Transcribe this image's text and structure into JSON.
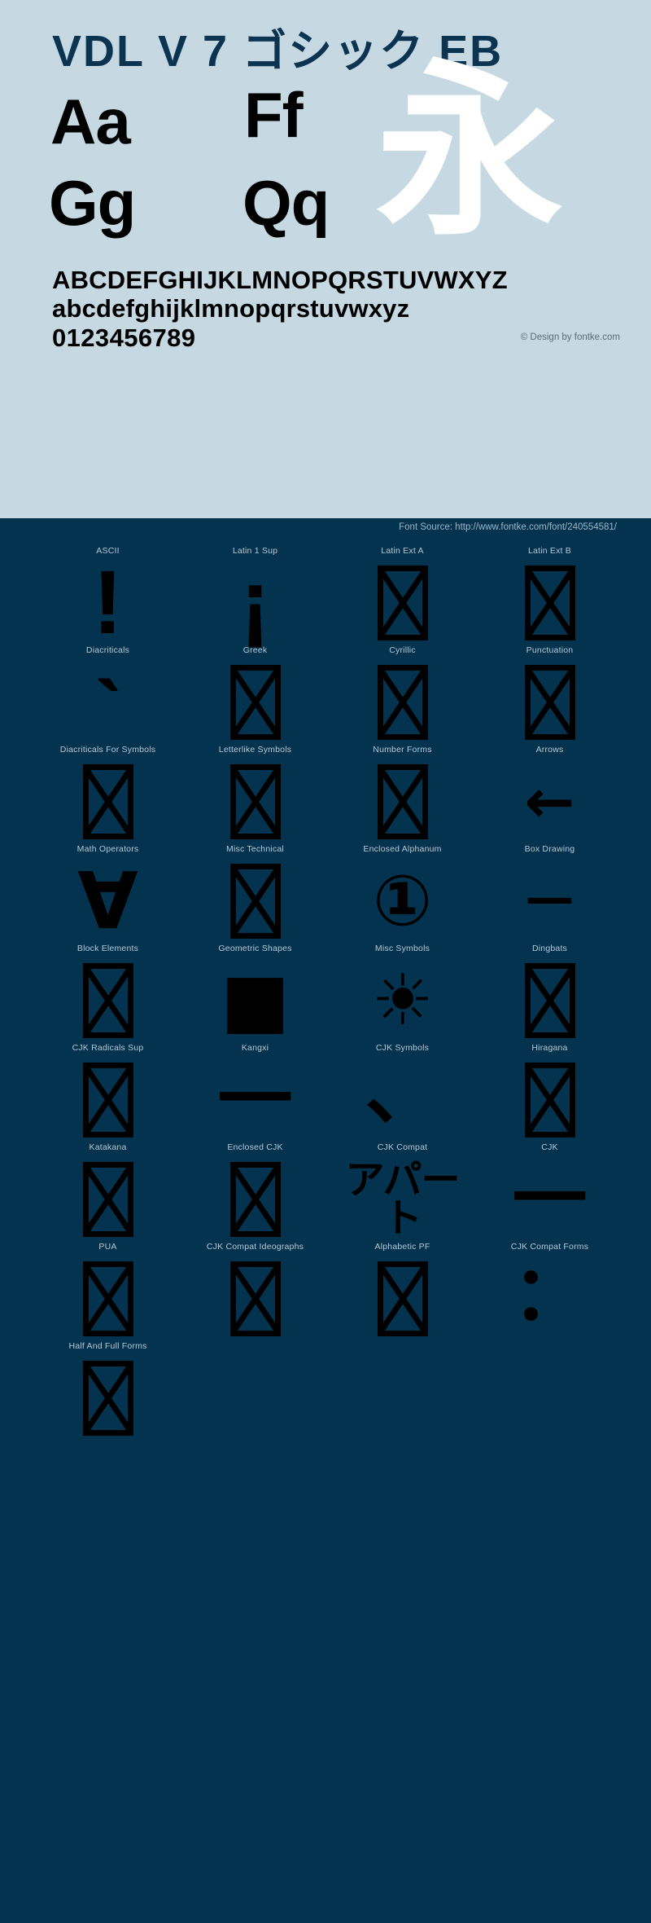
{
  "specimen": {
    "title": "VDL V 7 ゴシック EB",
    "samples": {
      "aa": "Aa",
      "ff": "Ff",
      "gg": "Gg",
      "qq": "Qq",
      "cjk": "永"
    },
    "alphabet": {
      "uppercase": "ABCDEFGHIJKLMNOPQRSTUVWXYZ",
      "lowercase": "abcdefghijklmnopqrstuvwxyz",
      "digits": "0123456789"
    },
    "credit": "© Design by fontke.com",
    "colors": {
      "specimen_background": "#c6d9e2",
      "title": "#0c3450",
      "glyph_black": "#000000",
      "cjk_white": "#ffffff",
      "panel_background": "#043350",
      "label": "#b6c8d4"
    }
  },
  "source_bar": {
    "text": "Font Source: http://www.fontke.com/font/240554581/"
  },
  "glyph_grid": {
    "cells": [
      {
        "label": "ASCII",
        "glyph": "!",
        "kind": "real",
        "style": "g-exclam"
      },
      {
        "label": "Latin 1 Sup",
        "glyph": "¡",
        "kind": "real",
        "style": "g-invexcl"
      },
      {
        "label": "Latin Ext A",
        "glyph": "",
        "kind": "tofu",
        "style": ""
      },
      {
        "label": "Latin Ext B",
        "glyph": "",
        "kind": "tofu",
        "style": ""
      },
      {
        "label": "Diacriticals",
        "glyph": "ˋ",
        "kind": "real",
        "style": "g-grave"
      },
      {
        "label": "Greek",
        "glyph": "",
        "kind": "tofu",
        "style": ""
      },
      {
        "label": "Cyrillic",
        "glyph": "",
        "kind": "tofu",
        "style": ""
      },
      {
        "label": "Punctuation",
        "glyph": "",
        "kind": "tofu",
        "style": ""
      },
      {
        "label": "Diacriticals For Symbols",
        "glyph": "",
        "kind": "tofu",
        "style": ""
      },
      {
        "label": "Letterlike Symbols",
        "glyph": "",
        "kind": "tofu",
        "style": ""
      },
      {
        "label": "Number Forms",
        "glyph": "",
        "kind": "tofu",
        "style": ""
      },
      {
        "label": "Arrows",
        "glyph": "←",
        "kind": "real",
        "style": "g-arrow"
      },
      {
        "label": "Math Operators",
        "glyph": "∀",
        "kind": "real",
        "style": "g-forall"
      },
      {
        "label": "Misc Technical",
        "glyph": "",
        "kind": "tofu",
        "style": ""
      },
      {
        "label": "Enclosed Alphanum",
        "glyph": "①",
        "kind": "real",
        "style": "g-circled1"
      },
      {
        "label": "Box Drawing",
        "glyph": "─",
        "kind": "real",
        "style": "g-boxline"
      },
      {
        "label": "Block Elements",
        "glyph": "",
        "kind": "tofu",
        "style": ""
      },
      {
        "label": "Geometric Shapes",
        "glyph": "■",
        "kind": "real",
        "style": "g-square"
      },
      {
        "label": "Misc Symbols",
        "glyph": "☀",
        "kind": "real",
        "style": "g-sun"
      },
      {
        "label": "Dingbats",
        "glyph": "",
        "kind": "tofu",
        "style": ""
      },
      {
        "label": "CJK Radicals Sup",
        "glyph": "",
        "kind": "tofu",
        "style": ""
      },
      {
        "label": "Kangxi",
        "glyph": "一",
        "kind": "real",
        "style": "g-kangxi"
      },
      {
        "label": "CJK Symbols",
        "glyph": "、",
        "kind": "real",
        "style": "g-cjkcomma"
      },
      {
        "label": "Hiragana",
        "glyph": "",
        "kind": "tofu",
        "style": ""
      },
      {
        "label": "Katakana",
        "glyph": "",
        "kind": "tofu",
        "style": ""
      },
      {
        "label": "Enclosed CJK",
        "glyph": "",
        "kind": "tofu",
        "style": ""
      },
      {
        "label": "CJK Compat",
        "glyph": "アパート",
        "kind": "real",
        "style": "g-cjkcompat"
      },
      {
        "label": "CJK",
        "glyph": "一",
        "kind": "real",
        "style": "g-cjkbar"
      },
      {
        "label": "PUA",
        "glyph": "",
        "kind": "tofu",
        "style": ""
      },
      {
        "label": "CJK Compat Ideographs",
        "glyph": "",
        "kind": "tofu",
        "style": ""
      },
      {
        "label": "Alphabetic PF",
        "glyph": "",
        "kind": "tofu",
        "style": ""
      },
      {
        "label": "CJK Compat Forms",
        "glyph": "：",
        "kind": "real",
        "style": "g-colonpts"
      },
      {
        "label": "Half And Full Forms",
        "glyph": "",
        "kind": "tofu",
        "style": ""
      }
    ]
  }
}
